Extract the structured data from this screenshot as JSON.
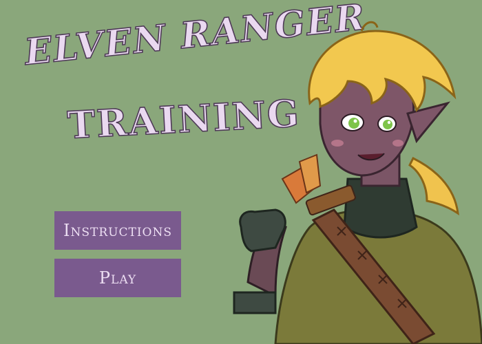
{
  "title": {
    "line1": "ELVEN RANGER",
    "line2": "TRAINING"
  },
  "menu": {
    "instructions_label": "Instructions",
    "play_label": "Play"
  },
  "colors": {
    "background": "#8aa77b",
    "button": "#7a5a8e",
    "title_fill": "#ead9f0",
    "title_outline": "#4e3a57"
  },
  "character": {
    "icon": "elf-ranger-character"
  }
}
